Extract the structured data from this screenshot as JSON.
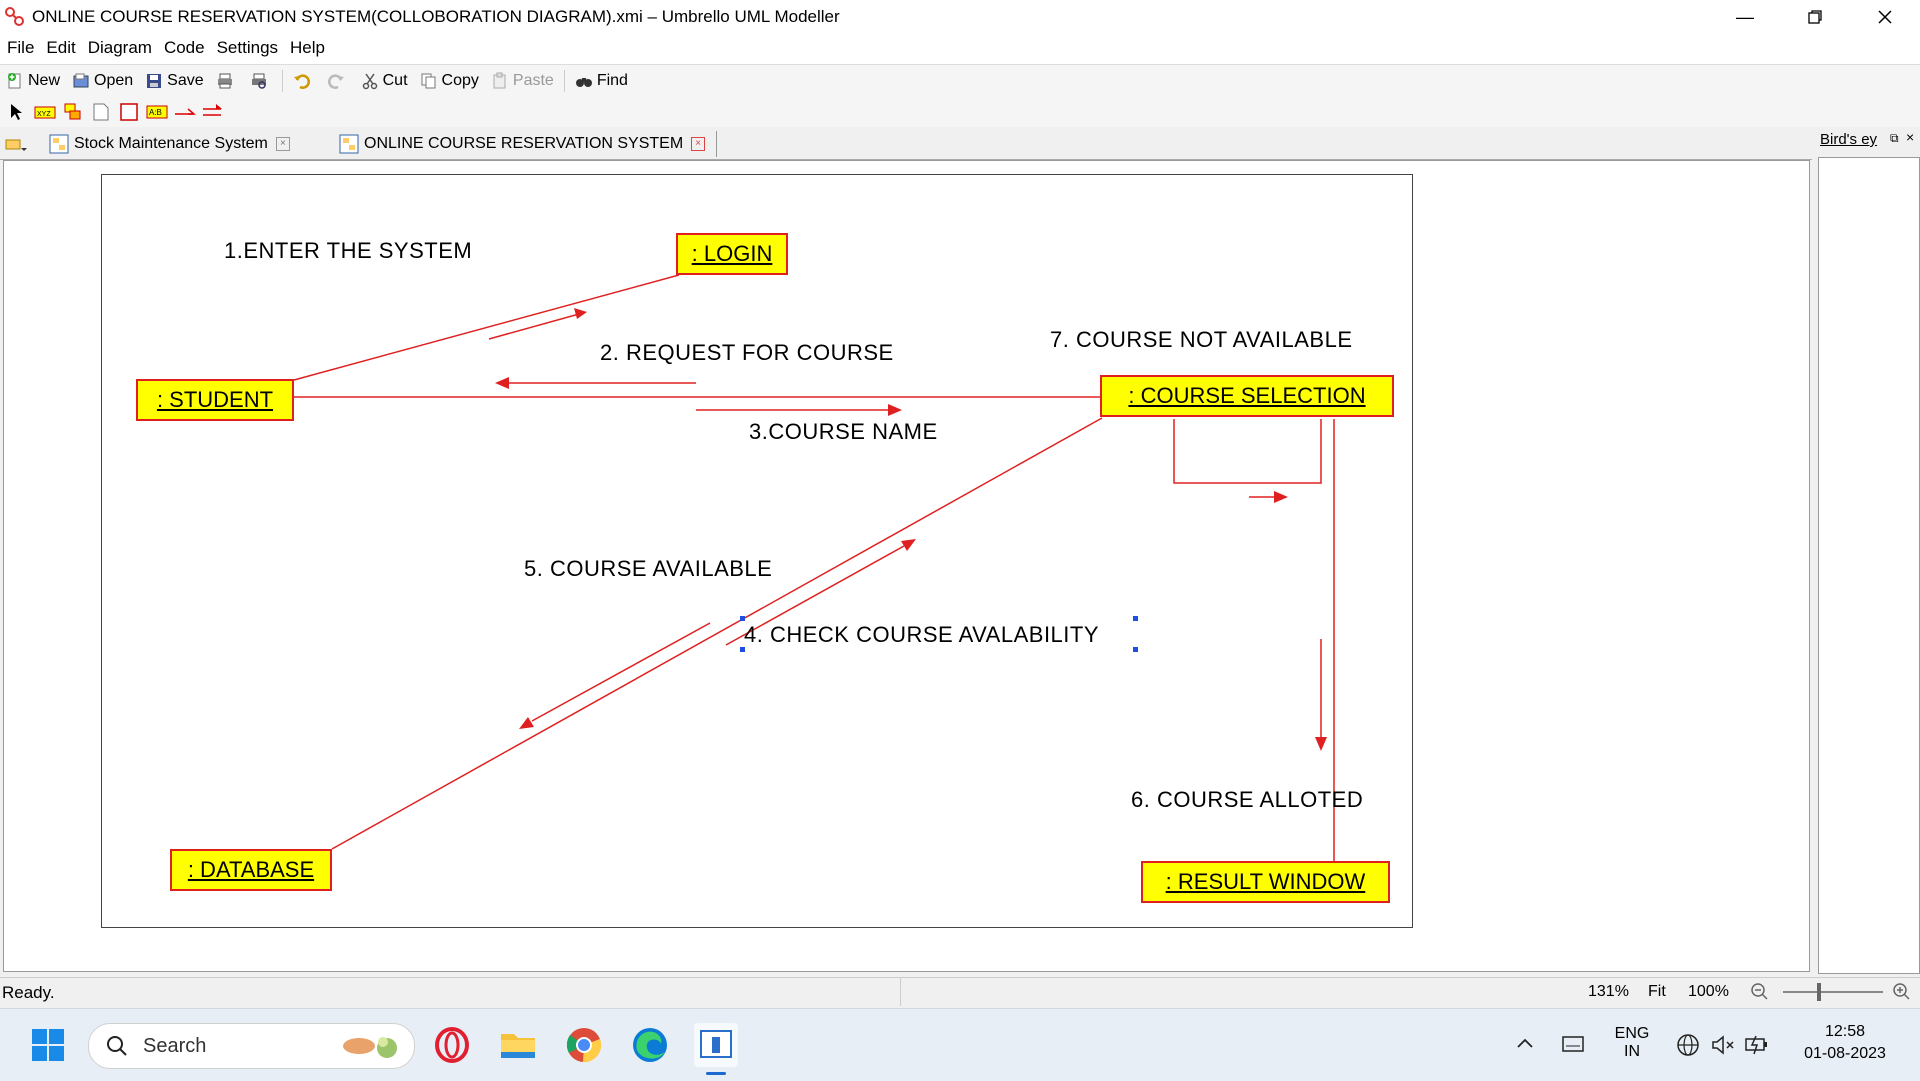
{
  "window": {
    "title": "ONLINE COURSE RESERVATION SYSTEM(COLLOBORATION DIAGRAM).xmi – Umbrello UML Modeller"
  },
  "menu": [
    "File",
    "Edit",
    "Diagram",
    "Code",
    "Settings",
    "Help"
  ],
  "toolbar": {
    "new": "New",
    "open": "Open",
    "save": "Save",
    "cut": "Cut",
    "copy": "Copy",
    "paste": "Paste",
    "find": "Find"
  },
  "tabs": [
    {
      "label": "Stock Maintenance System"
    },
    {
      "label": "ONLINE COURSE RESERVATION SYSTEM"
    }
  ],
  "tool_palette_text": "A:B",
  "diagram": {
    "objects": {
      "login": ": LOGIN",
      "student": ": STUDENT",
      "course_selection": ": COURSE SELECTION",
      "database": ": DATABASE",
      "result_window": ": RESULT WINDOW"
    },
    "messages": {
      "m1": "1.ENTER THE SYSTEM",
      "m2": "2. REQUEST FOR COURSE",
      "m3": "3.COURSE NAME",
      "m4": "4. CHECK COURSE AVALABILITY",
      "m5": "5. COURSE AVAILABLE",
      "m6": "6. COURSE ALLOTED",
      "m7": "7. COURSE NOT AVAILABLE"
    },
    "line_color": "#e02020",
    "object_fill": "#ffff00"
  },
  "birds_eye": {
    "title": "Bird's ey"
  },
  "status": {
    "text": "Ready.",
    "zoom": "131%",
    "fit": "Fit",
    "hundred": "100%"
  },
  "taskbar": {
    "search": "Search",
    "lang1": "ENG",
    "lang2": "IN",
    "time": "12:58",
    "date": "01-08-2023"
  }
}
